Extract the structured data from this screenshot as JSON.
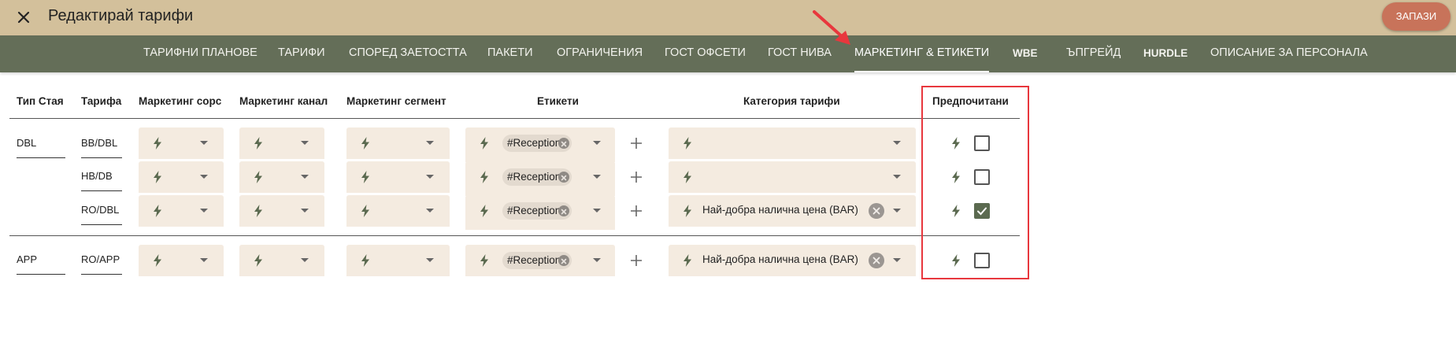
{
  "header": {
    "title": "Редактирай тарифи",
    "save_label": "ЗАПАЗИ"
  },
  "tabs": [
    {
      "label": "ТАРИФНИ ПЛАНОВЕ",
      "active": false
    },
    {
      "label": "ТАРИФИ",
      "active": false
    },
    {
      "label": "СПОРЕД ЗАЕТОСТТА",
      "active": false
    },
    {
      "label": "ПАКЕТИ",
      "active": false
    },
    {
      "label": "ОГРАНИЧЕНИЯ",
      "active": false
    },
    {
      "label": "ГОСТ ОФСЕТИ",
      "active": false
    },
    {
      "label": "ГОСТ НИВА",
      "active": false
    },
    {
      "label": "МАРКЕТИНГ & ЕТИКЕТИ",
      "active": true
    },
    {
      "label": "WBE",
      "active": false
    },
    {
      "label": "ЪПГРЕЙД",
      "active": false
    },
    {
      "label": "HURDLE",
      "active": false
    },
    {
      "label": "ОПИСАНИЕ ЗА ПЕРСОНАЛА",
      "active": false
    }
  ],
  "table": {
    "headers": {
      "room_type": "Тип Стая",
      "rate": "Тарифа",
      "mkt_source": "Маркетинг сорс",
      "mkt_channel": "Маркетинг канал",
      "mkt_segment": "Маркетинг сегмент",
      "tags": "Етикети",
      "rate_category": "Категория тарифи",
      "preferred": "Предпочитани"
    },
    "groups": [
      {
        "room_type": "DBL",
        "rows": [
          {
            "rate": "BB/DBL",
            "tag": "#Reception",
            "category": "",
            "preferred": false
          },
          {
            "rate": "HB/DB",
            "tag": "#Reception",
            "category": "",
            "preferred": false
          },
          {
            "rate": "RO/DBL",
            "tag": "#Reception",
            "category": "Най-добра налична цена (BAR)",
            "preferred": true
          }
        ]
      },
      {
        "room_type": "APP",
        "rows": [
          {
            "rate": "RO/APP",
            "tag": "#Reception",
            "category": "Най-добра налична цена (BAR)",
            "preferred": false
          }
        ]
      }
    ]
  },
  "colors": {
    "header_bg": "#d3c09b",
    "tabbar_bg": "#646e58",
    "save_button": "#c8735a",
    "field_bg": "#f4ebe0",
    "bolt": "#5b6a50",
    "highlight": "#e8373d"
  },
  "icons": {
    "close": "close-icon",
    "bolt": "lightning-bolt-icon",
    "caret": "chevron-down-icon",
    "add": "plus-icon",
    "chip_remove": "cancel-circle-icon"
  }
}
